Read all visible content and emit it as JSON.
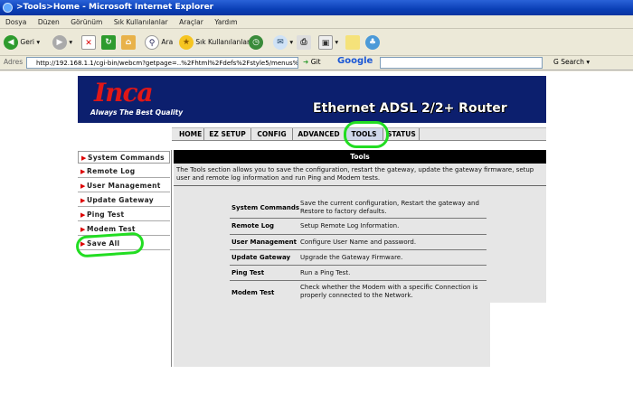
{
  "window": {
    "title": ">Tools>Home - Microsoft Internet Explorer"
  },
  "menu": [
    "Dosya",
    "Düzen",
    "Görünüm",
    "Sık Kullanılanlar",
    "Araçlar",
    "Yardım"
  ],
  "toolbar": {
    "back": "Geri",
    "search": "Ara",
    "favorites": "Sık Kullanılanlar"
  },
  "address": {
    "label": "Adres",
    "url": "http://192.168.1.1/cgi-bin/webcm?getpage=..%2Fhtml%2Fdefs%2Fstyle5/menus%",
    "go": "Git",
    "google": "Google",
    "search": "Search"
  },
  "banner": {
    "logo": "Inca",
    "slogan": "Always The Best Quality",
    "product": "Ethernet ADSL 2/2+ Router"
  },
  "nav": {
    "tabs": [
      "HOME",
      "EZ SETUP",
      "CONFIG",
      "ADVANCED",
      "TOOLS",
      "STATUS"
    ],
    "active": "TOOLS"
  },
  "sidebar": {
    "items": [
      "System Commands",
      "Remote Log",
      "User Management",
      "Update Gateway",
      "Ping Test",
      "Modem Test",
      "Save All"
    ]
  },
  "main": {
    "title": "Tools",
    "intro": "The Tools section allows you to save the configuration, restart the gateway, update the gateway firmware, setup user and remote log information and run Ping and Modem tests.",
    "rows": [
      {
        "name": "System Commands",
        "desc": "Save the current configuration, Restart the gateway and Restore to factory defaults."
      },
      {
        "name": "Remote Log",
        "desc": "Setup Remote Log Information."
      },
      {
        "name": "User Management",
        "desc": "Configure User Name and password."
      },
      {
        "name": "Update Gateway",
        "desc": "Upgrade the Gateway Firmware."
      },
      {
        "name": "Ping Test",
        "desc": "Run a Ping Test."
      },
      {
        "name": "Modem Test",
        "desc": "Check whether the Modem with a specific Connection is properly connected to the Network."
      }
    ]
  },
  "colors": {
    "highlight": "#22dd22",
    "banner": "#0c1f6e",
    "logo": "#e01717"
  }
}
